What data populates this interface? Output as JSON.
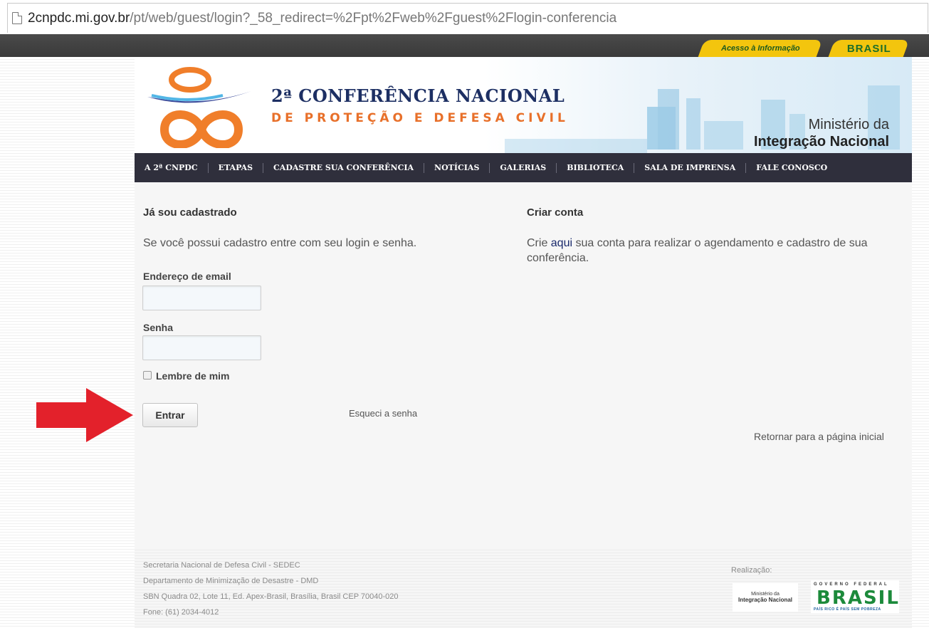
{
  "browser": {
    "url_host": "2cnpdc.mi.gov.br",
    "url_path": "/pt/web/guest/login?_58_redirect=%2Fpt%2Fweb%2Fguest%2Flogin-conferencia",
    "page_icon": "page-icon"
  },
  "govbar": {
    "acesso_label": "Acesso à Informação",
    "brasil_label": "BRASIL",
    "tab_color": "#f3c50e"
  },
  "header": {
    "title_line1": "2ª CONFERÊNCIA NACIONAL",
    "title_line2": "DE PROTEÇÃO E DEFESA CIVIL",
    "ministerio_line1": "Ministério da",
    "ministerio_line2": "Integração Nacional"
  },
  "nav": {
    "items": [
      "A 2ª CNPDC",
      "ETAPAS",
      "CADASTRE SUA CONFERÊNCIA",
      "NOTÍCIAS",
      "GALERIAS",
      "BIBLIOTECA",
      "SALA DE IMPRENSA",
      "FALE CONOSCO"
    ]
  },
  "login": {
    "heading": "Já sou cadastrado",
    "description": "Se você possui cadastro entre com seu login e senha.",
    "email_label": "Endereço de email",
    "email_value": "",
    "password_label": "Senha",
    "password_value": "",
    "remember_label": "Lembre de mim",
    "remember_checked": false,
    "submit_label": "Entrar",
    "forgot_label": "Esqueci a senha"
  },
  "create": {
    "heading": "Criar conta",
    "text_before": "Crie ",
    "link_text": "aqui",
    "text_after": " sua conta para realizar o agendamento e cadastro de sua conferência."
  },
  "return_link": "Retornar para a página inicial",
  "footer": {
    "lines": [
      "Secretaria Nacional de Defesa Civil - SEDEC",
      "Departamento de Minimização de Desastre - DMD",
      "SBN Quadra 02, Lote 11, Ed. Apex-Brasil, Brasília, Brasil CEP 70040-020",
      "Fone: (61) 2034-4012"
    ],
    "realizacao": "Realização:",
    "mi_logo_line1": "Ministério da",
    "mi_logo_line2": "Integração Nacional",
    "gov_federal": "GOVERNO FEDERAL",
    "brasil": "BRASIL",
    "brasil_slogan": "PAÍS RICO É PAÍS SEM POBREZA"
  },
  "annotation": {
    "arrow_color": "#e3212b",
    "arrow_icon": "red-arrow-icon"
  }
}
